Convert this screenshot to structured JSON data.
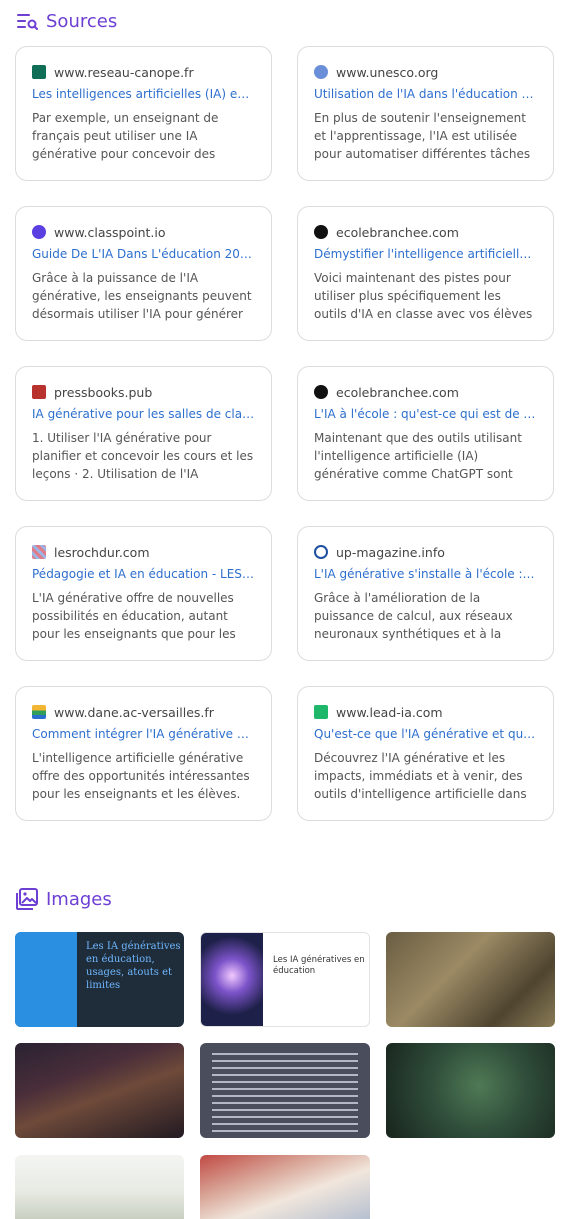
{
  "sources": {
    "heading": "Sources",
    "heading_icon": "sources-search-icon",
    "cards": [
      {
        "host": "www.reseau-canope.fr",
        "favicon": "canope-favicon",
        "favicon_color": "#0f6e55",
        "title": "Les intelligences artificielles (IA) en é…",
        "snippet": "Par exemple, un enseignant de français peut utiliser une IA générative pour concevoir des textes à trous, des quiz"
      },
      {
        "host": "www.unesco.org",
        "favicon": "unesco-favicon",
        "favicon_color": "#6a8fd8",
        "title": "Utilisation de l'IA dans l'éducation : d…",
        "snippet": "En plus de soutenir l'enseignement et l'apprentissage, l'IA est utilisée pour automatiser différentes tâches"
      },
      {
        "host": "www.classpoint.io",
        "favicon": "classpoint-favicon",
        "favicon_color": "#5b3fe0",
        "title": "Guide De L'IA Dans L'éducation 2023…",
        "snippet": "Grâce à la puissance de l'IA générative, les enseignants peuvent désormais utiliser l'IA pour générer des images et"
      },
      {
        "host": "ecolebranchee.com",
        "favicon": "ecolebranchee-favicon",
        "favicon_color": "#111111",
        "title": "Démystifier l'intelligence artificielle e…",
        "snippet": "Voici maintenant des pistes pour utiliser plus spécifiquement les outils d'IA en classe avec vos élèves et pour"
      },
      {
        "host": "pressbooks.pub",
        "favicon": "pressbooks-favicon",
        "favicon_color": "#b8322e",
        "title": "IA générative pour les salles de class…",
        "snippet": "1. Utiliser l'IA générative pour planifier et concevoir les cours et les leçons · 2. Utilisation de l'IA générative dans la"
      },
      {
        "host": "ecolebranchee.com",
        "favicon": "ecolebranchee-favicon",
        "favicon_color": "#111111",
        "title": "L'IA à l'école : qu'est-ce qui est de la …",
        "snippet": "Maintenant que des outils utilisant l'intelligence artificielle (IA) générative comme ChatGPT sont accessibles à"
      },
      {
        "host": "lesrochdur.com",
        "favicon": "lesrochdur-favicon",
        "favicon_color": "#e07b8a",
        "title": "Pédagogie et IA en éducation - LES R…",
        "snippet": "L'IA générative offre de nouvelles possibilités en éducation, autant pour les enseignants que pour les"
      },
      {
        "host": "up-magazine.info",
        "favicon": "upmagazine-favicon",
        "favicon_color": "#1e4fa0",
        "title": "L'IA générative s'installe à l'école : c…",
        "snippet": "Grâce à l'amélioration de la puissance de calcul, aux réseaux neuronaux synthétiques et à la modélisation du"
      },
      {
        "host": "www.dane.ac-versailles.fr",
        "favicon": "dane-favicon",
        "favicon_color": "#2f9e5a",
        "title": "Comment intégrer l'IA générative da…",
        "snippet": "L'intelligence artificielle générative offre des opportunités intéressantes pour les enseignants et les élèves."
      },
      {
        "host": "www.lead-ia.com",
        "favicon": "leadia-favicon",
        "favicon_color": "#1fb86b",
        "title": "Qu'est-ce que l'IA générative et quell…",
        "snippet": "Découvrez l'IA générative et les impacts, immédiats et à venir, des outils d'intelligence artificielle dans le"
      }
    ]
  },
  "images": {
    "heading": "Images",
    "heading_icon": "images-icon",
    "thumb1_text": "Les IA génératives en éducation, usages, atouts et limites",
    "thumb2_text": "Les IA génératives en éducation"
  },
  "colors": {
    "accent": "#6d3fd3",
    "link": "#2d6fce"
  }
}
